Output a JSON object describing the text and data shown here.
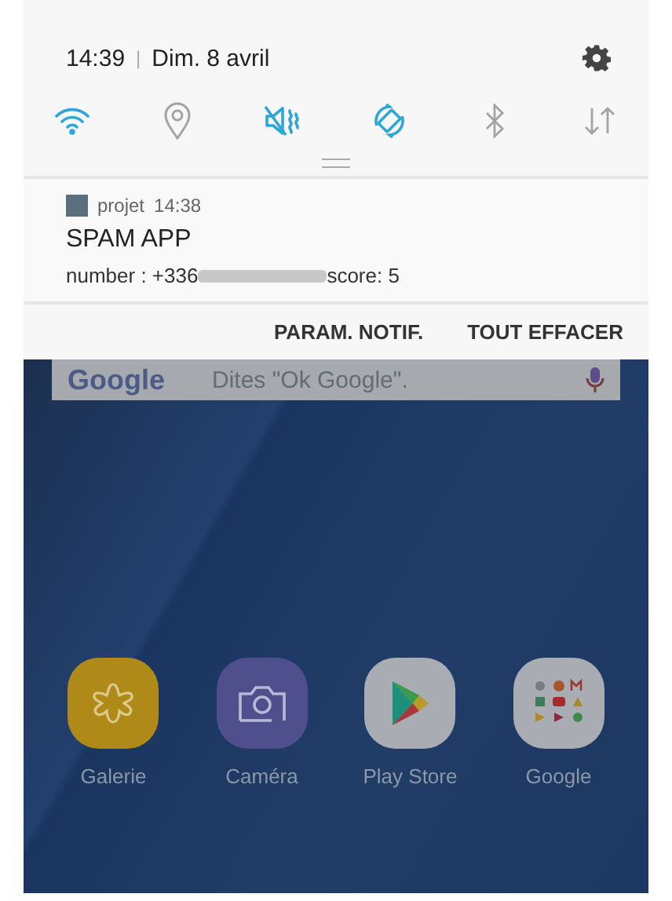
{
  "status": {
    "time": "14:39",
    "separator": "|",
    "date": "Dim. 8 avril"
  },
  "toggles": [
    {
      "kind": "wifi",
      "on": true
    },
    {
      "kind": "location",
      "on": false
    },
    {
      "kind": "vibrate",
      "on": true
    },
    {
      "kind": "rotate",
      "on": true
    },
    {
      "kind": "bluetooth",
      "on": false
    },
    {
      "kind": "data",
      "on": false
    }
  ],
  "notification": {
    "app": "projet",
    "time": "14:38",
    "title": "SPAM APP",
    "number_label": "number : +336",
    "score": "score: 5"
  },
  "actions": [
    "PARAM. NOTIF.",
    "TOUT EFFACER"
  ],
  "search_bar": {
    "logo": "Google",
    "placeholder": "Dites \"Ok Google\"."
  },
  "apps": [
    {
      "kind": "gallery",
      "label": "Galerie"
    },
    {
      "kind": "camera",
      "label": "Caméra"
    },
    {
      "kind": "store",
      "label": "Play Store"
    },
    {
      "kind": "folder",
      "label": "Google"
    }
  ]
}
